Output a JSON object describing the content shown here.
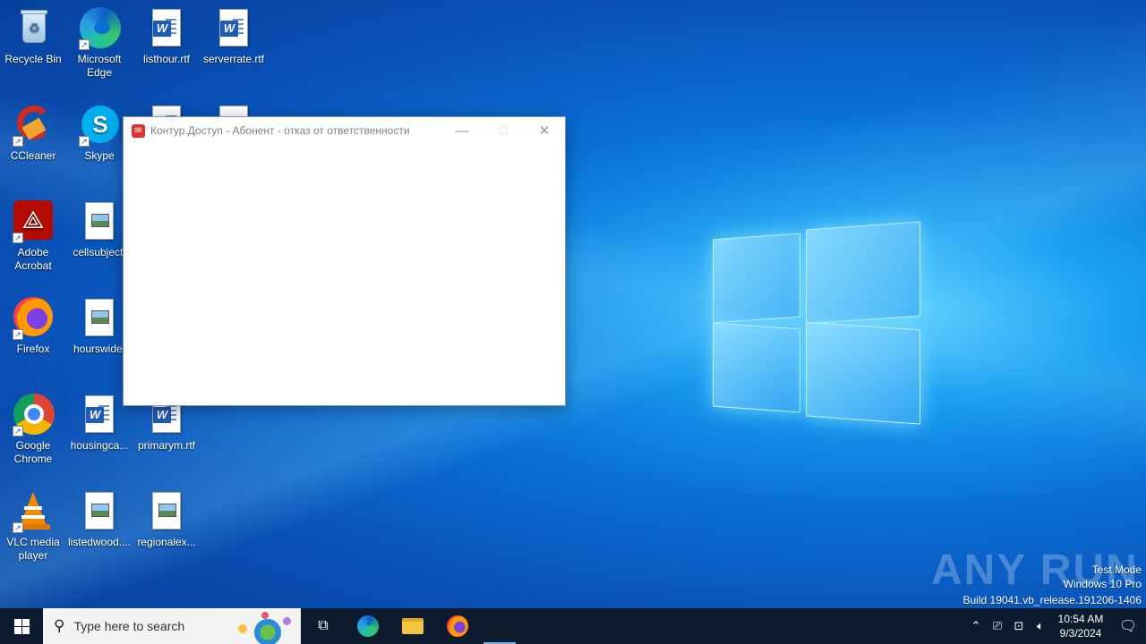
{
  "desktop": {
    "icons": [
      {
        "label": "Recycle Bin"
      },
      {
        "label": "Microsoft Edge"
      },
      {
        "label": "listhour.rtf"
      },
      {
        "label": "serverrate.rtf"
      },
      {
        "label": "CCleaner"
      },
      {
        "label": "Skype"
      },
      {
        "label": "Adobe Acrobat"
      },
      {
        "label": "cellsubject."
      },
      {
        "label": "Firefox"
      },
      {
        "label": "hourswide."
      },
      {
        "label": "Google Chrome"
      },
      {
        "label": "housingca..."
      },
      {
        "label": "primarym.rtf"
      },
      {
        "label": "VLC media player"
      },
      {
        "label": "listedwood...."
      },
      {
        "label": "regionalex..."
      }
    ]
  },
  "dialog": {
    "title": "Контур.Доступ - Абонент - отказ от ответственности",
    "minimize": "—",
    "maximize": "☐",
    "close": "✕"
  },
  "watermark": {
    "brand": "ANY RUN",
    "line1": "Test Mode",
    "line2": "Windows 10 Pro",
    "line3": "Build 19041.vb_release.191206-1406"
  },
  "taskbar": {
    "search_placeholder": "Type here to search",
    "time": "10:54 AM",
    "date": "9/3/2024"
  },
  "colors": {
    "taskbar": "#0c1b2e",
    "desktop_accent": "#0a6fd6"
  }
}
